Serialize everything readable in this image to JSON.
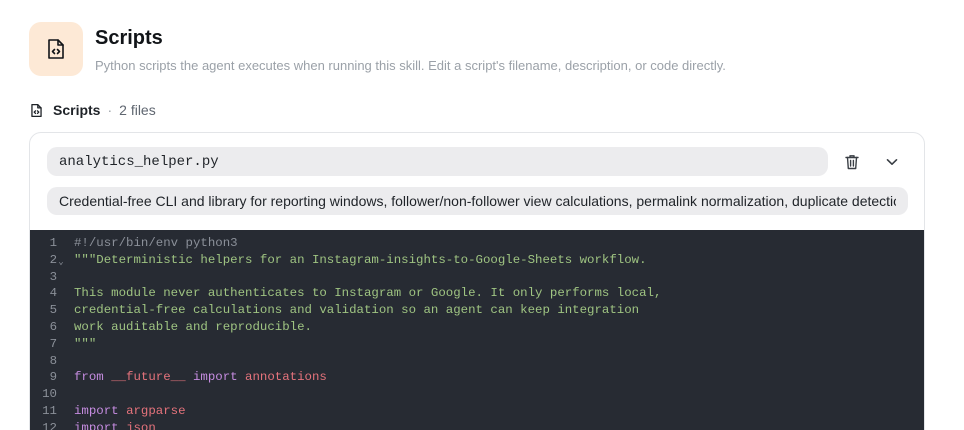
{
  "header": {
    "icon": "code-file-icon",
    "title": "Scripts",
    "subtitle": "Python scripts the agent executes when running this skill. Edit a script's filename, description, or code directly."
  },
  "section": {
    "icon": "code-file-icon",
    "label": "Scripts",
    "separator": "·",
    "count": "2 files"
  },
  "script": {
    "filename": "analytics_helper.py",
    "description": "Credential-free CLI and library for reporting windows, follower/non-follower view calculations, permalink normalization, duplicate detection",
    "actions": {
      "delete_icon": "trash-icon",
      "collapse_icon": "chevron-down-icon"
    }
  },
  "editor": {
    "colors": {
      "background": "#272b33",
      "comment": "#8b9099",
      "string": "#9fc482",
      "keyword": "#c58ce0",
      "module": "#e5737c"
    },
    "lines": [
      {
        "n": "1",
        "fold": "",
        "tokens": [
          {
            "t": "comment",
            "v": "#!/usr/bin/env python3"
          }
        ]
      },
      {
        "n": "2",
        "fold": "⌄",
        "tokens": [
          {
            "t": "string",
            "v": "\"\"\"Deterministic helpers for an Instagram-insights-to-Google-Sheets workflow."
          }
        ]
      },
      {
        "n": "3",
        "fold": "",
        "tokens": []
      },
      {
        "n": "4",
        "fold": "",
        "tokens": [
          {
            "t": "string",
            "v": "This module never authenticates to Instagram or Google. It only performs local,"
          }
        ]
      },
      {
        "n": "5",
        "fold": "",
        "tokens": [
          {
            "t": "string",
            "v": "credential-free calculations and validation so an agent can keep integration"
          }
        ]
      },
      {
        "n": "6",
        "fold": "",
        "tokens": [
          {
            "t": "string",
            "v": "work auditable and reproducible."
          }
        ]
      },
      {
        "n": "7",
        "fold": "",
        "tokens": [
          {
            "t": "string",
            "v": "\"\"\""
          }
        ]
      },
      {
        "n": "8",
        "fold": "",
        "tokens": []
      },
      {
        "n": "9",
        "fold": "",
        "tokens": [
          {
            "t": "kw",
            "v": "from"
          },
          {
            "t": "plain",
            "v": " "
          },
          {
            "t": "mod",
            "v": "__future__"
          },
          {
            "t": "plain",
            "v": " "
          },
          {
            "t": "kw",
            "v": "import"
          },
          {
            "t": "plain",
            "v": " "
          },
          {
            "t": "mod",
            "v": "annotations"
          }
        ]
      },
      {
        "n": "10",
        "fold": "",
        "tokens": []
      },
      {
        "n": "11",
        "fold": "",
        "tokens": [
          {
            "t": "kw",
            "v": "import"
          },
          {
            "t": "plain",
            "v": " "
          },
          {
            "t": "mod",
            "v": "argparse"
          }
        ]
      },
      {
        "n": "12",
        "fold": "",
        "tokens": [
          {
            "t": "kw",
            "v": "import"
          },
          {
            "t": "plain",
            "v": " "
          },
          {
            "t": "mod",
            "v": "json"
          }
        ]
      }
    ]
  }
}
